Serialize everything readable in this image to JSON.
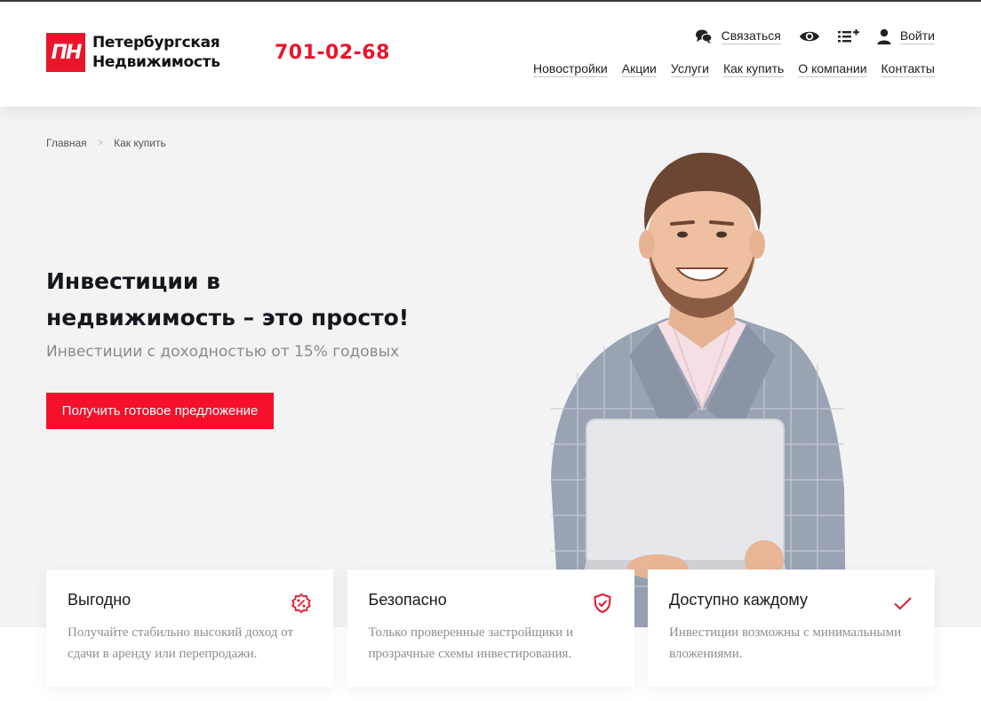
{
  "brand": {
    "mark": "ПН",
    "name_line1": "Петербургская",
    "name_line2": "Недвижимость",
    "accent": "#e8152b"
  },
  "header": {
    "phone": "701-02-68",
    "contact_label": "Связаться",
    "login_label": "Войти",
    "icons": [
      "chat-icon",
      "eye-icon",
      "list-add-icon",
      "user-icon"
    ]
  },
  "nav": {
    "items": [
      {
        "label": "Новостройки"
      },
      {
        "label": "Акции"
      },
      {
        "label": "Услуги"
      },
      {
        "label": "Как купить"
      },
      {
        "label": "О компании"
      },
      {
        "label": "Контакты"
      }
    ]
  },
  "breadcrumb": {
    "items": [
      "Главная",
      "Как купить"
    ]
  },
  "hero": {
    "title_line1": "Инвестиции в",
    "title_line2": "недвижимость – это просто!",
    "subtitle": "Инвестиции с доходностью от 15% годовых",
    "cta_label": "Получить готовое предложение"
  },
  "features": [
    {
      "title": "Выгодно",
      "text": "Получайте стабильно высокий доход от сдачи в аренду или перепродажи.",
      "icon": "percent-badge-icon"
    },
    {
      "title": "Безопасно",
      "text": "Только проверенные застройщики и прозрачные схемы инвестирования.",
      "icon": "shield-check-icon"
    },
    {
      "title": "Доступно каждому",
      "text": "Инвестиции возможны с минимальными вложениями.",
      "icon": "checkmark-icon"
    }
  ]
}
